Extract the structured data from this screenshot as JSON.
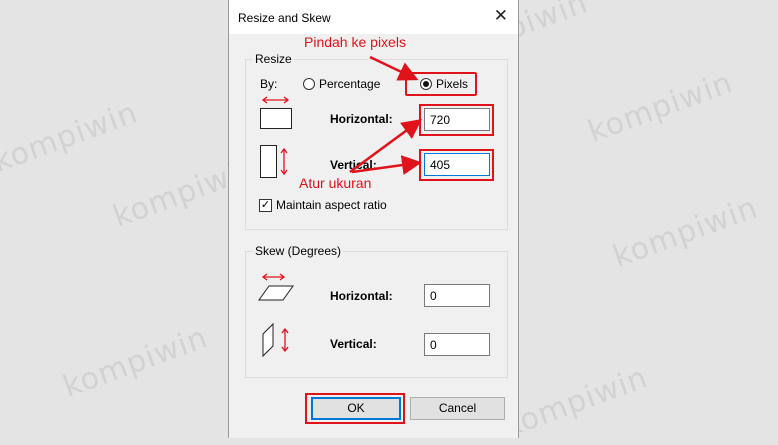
{
  "watermark": {
    "text": "kompiwin"
  },
  "dialog": {
    "title": "Resize and Skew",
    "close_glyph": "✕",
    "resize": {
      "legend": "Resize",
      "by_label": "By:",
      "percentage_label": "Percentage",
      "pixels_label": "Pixels",
      "selected": "Pixels",
      "horizontal_label": "Horizontal:",
      "horizontal_value": "720",
      "vertical_label": "Vertical:",
      "vertical_value": "405",
      "maintain_label": "Maintain aspect ratio",
      "maintain_checked": true,
      "check_glyph": "✓"
    },
    "skew": {
      "legend": "Skew (Degrees)",
      "horizontal_label": "Horizontal:",
      "horizontal_value": "0",
      "vertical_label": "Vertical:",
      "vertical_value": "0"
    },
    "ok_label": "OK",
    "cancel_label": "Cancel"
  },
  "annotations": {
    "pixels_note": "Pindah ke pixels",
    "size_note": "Atur ukuran",
    "color": "#e0131a"
  },
  "colors": {
    "accent": "#0078d7",
    "annotation": "#e0131a"
  }
}
